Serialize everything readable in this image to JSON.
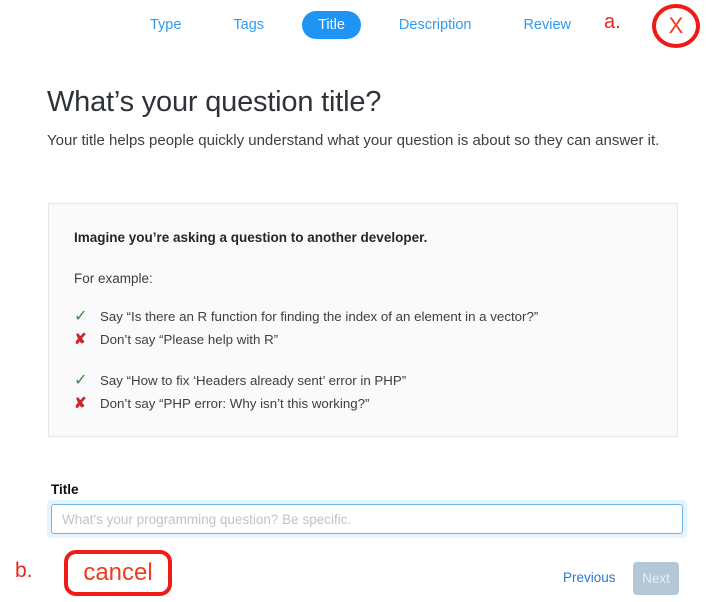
{
  "stepnav": {
    "steps": [
      {
        "label": "Type",
        "active": false
      },
      {
        "label": "Tags",
        "active": false
      },
      {
        "label": "Title",
        "active": true
      },
      {
        "label": "Description",
        "active": false
      },
      {
        "label": "Review",
        "active": false
      }
    ]
  },
  "annotations": {
    "a": {
      "label": "a.",
      "target_glyph": "X"
    },
    "b": {
      "label": "b.",
      "target_text": "cancel"
    }
  },
  "page": {
    "title": "What’s your question title?",
    "subtitle": "Your title helps people quickly understand what your question is about so they can answer it."
  },
  "tipbox": {
    "heading": "Imagine you’re asking a question to another developer.",
    "for_example": "For example:",
    "groups": [
      {
        "good": {
          "mark": "✓",
          "text": "Say “Is there an R function for finding the index of an element in a vector?”"
        },
        "bad": {
          "mark": "✘",
          "text": "Don’t say “Please help with R”"
        }
      },
      {
        "good": {
          "mark": "✓",
          "text": "Say “How to fix ‘Headers already sent’ error in PHP”"
        },
        "bad": {
          "mark": "✘",
          "text": "Don’t say “PHP error: Why isn’t this working?”"
        }
      }
    ]
  },
  "form": {
    "title_label": "Title",
    "title_value": "",
    "title_placeholder": "What's your programming question? Be specific."
  },
  "footer": {
    "previous_label": "Previous",
    "next_label": "Next"
  },
  "colors": {
    "accent_blue": "#1e95f5",
    "link_blue": "#2f9bf0",
    "annotation_red": "#ee1b16",
    "check_green": "#3d8b3d",
    "cross_red": "#c82a2a",
    "next_disabled_bg": "#b3c7d6"
  }
}
